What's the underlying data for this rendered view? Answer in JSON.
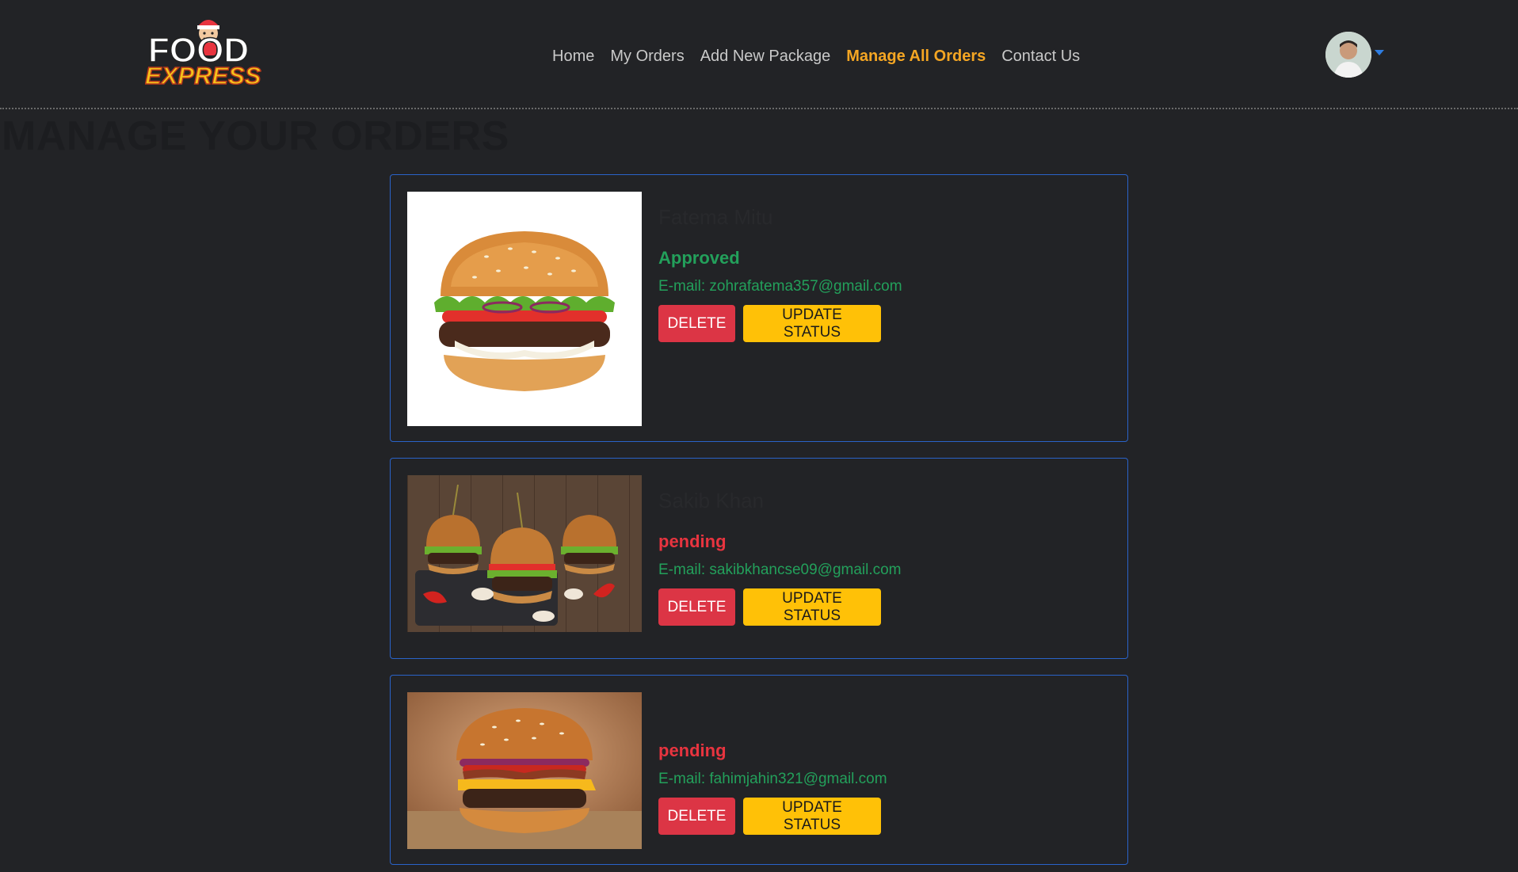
{
  "brand": {
    "logo_top": "FOOD",
    "logo_bottom": "EXPRESS"
  },
  "nav": {
    "items": [
      {
        "label": "Home",
        "active": false
      },
      {
        "label": "My Orders",
        "active": false
      },
      {
        "label": "Add New Package",
        "active": false
      },
      {
        "label": "Manage All Orders",
        "active": true
      },
      {
        "label": "Contact Us",
        "active": false
      }
    ]
  },
  "page": {
    "title": "MANAGE YOUR ORDERS"
  },
  "orders": [
    {
      "customer": "Fatema Mitu",
      "status": "Approved",
      "status_color": "#23a05b",
      "email": "E-mail: zohrafatema357@gmail.com",
      "delete_label": "DELETE",
      "update_label": "UPDATE STATUS",
      "image": "classic-burger-white-bg"
    },
    {
      "customer": "Sakib Khan",
      "status": "pending",
      "status_color": "#e8343f",
      "email": "E-mail: sakibkhancse09@gmail.com",
      "delete_label": "DELETE",
      "update_label": "UPDATE STATUS",
      "image": "mini-burgers-wood-table"
    },
    {
      "customer": "",
      "status": "pending",
      "status_color": "#e8343f",
      "email": "E-mail: fahimjahin321@gmail.com",
      "delete_label": "DELETE",
      "update_label": "UPDATE STATUS",
      "image": "cheeseburger-bacon"
    }
  ],
  "colors": {
    "background": "#222326",
    "active_nav": "#f5a623",
    "card_border": "#2a63c9",
    "delete": "#dc3545",
    "update": "#ffc107",
    "approved": "#23a05b",
    "pending": "#e8343f"
  }
}
